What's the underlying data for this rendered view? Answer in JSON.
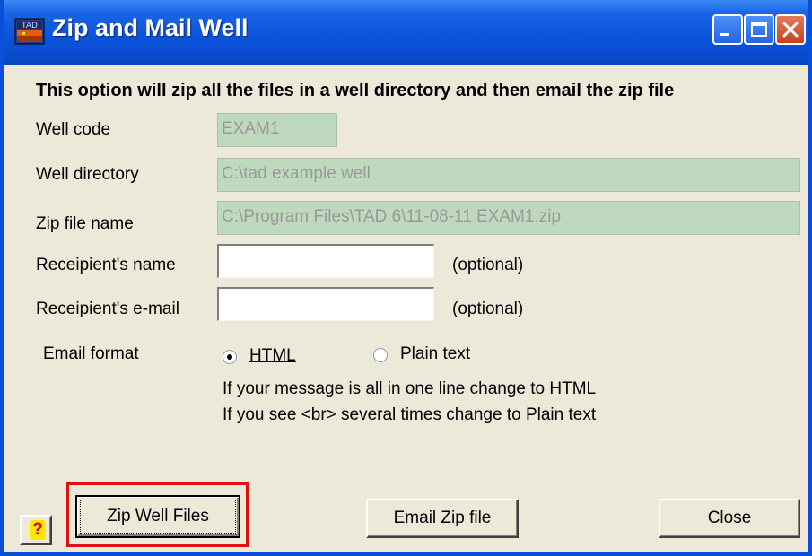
{
  "window": {
    "title": "Zip and Mail Well",
    "icon_text": "TAD",
    "controls": [
      "minimize-icon",
      "maximize-icon",
      "close-icon"
    ]
  },
  "description": "This option will zip all the files in a well directory and then email the zip file",
  "form": {
    "well_code": {
      "label": "Well code",
      "value": "EXAM1"
    },
    "well_directory": {
      "label": "Well directory",
      "value": "C:\\tad example well"
    },
    "zip_file_name": {
      "label": "Zip file name",
      "value": "C:\\Program Files\\TAD 6\\11-08-11 EXAM1.zip"
    },
    "recipient_name": {
      "label": "Receipient's name",
      "value": "",
      "note": "(optional)"
    },
    "recipient_email": {
      "label": "Receipient's e-mail",
      "value": "",
      "note": "(optional)"
    }
  },
  "email_format": {
    "label": "Email format",
    "options": [
      {
        "label": "HTML",
        "selected": true
      },
      {
        "label": "Plain text",
        "selected": false
      }
    ],
    "hints": [
      "If your message is all in one line change to HTML",
      "If you see <br> several times change to Plain text"
    ]
  },
  "buttons": {
    "help": "?",
    "zip": "Zip Well Files",
    "email": "Email Zip file",
    "close": "Close"
  },
  "colors": {
    "titlebar": "#0b54dd",
    "readonly_field": "#bfd9bf",
    "highlight": "#e01010",
    "dialog_bg": "#ece9d8"
  }
}
